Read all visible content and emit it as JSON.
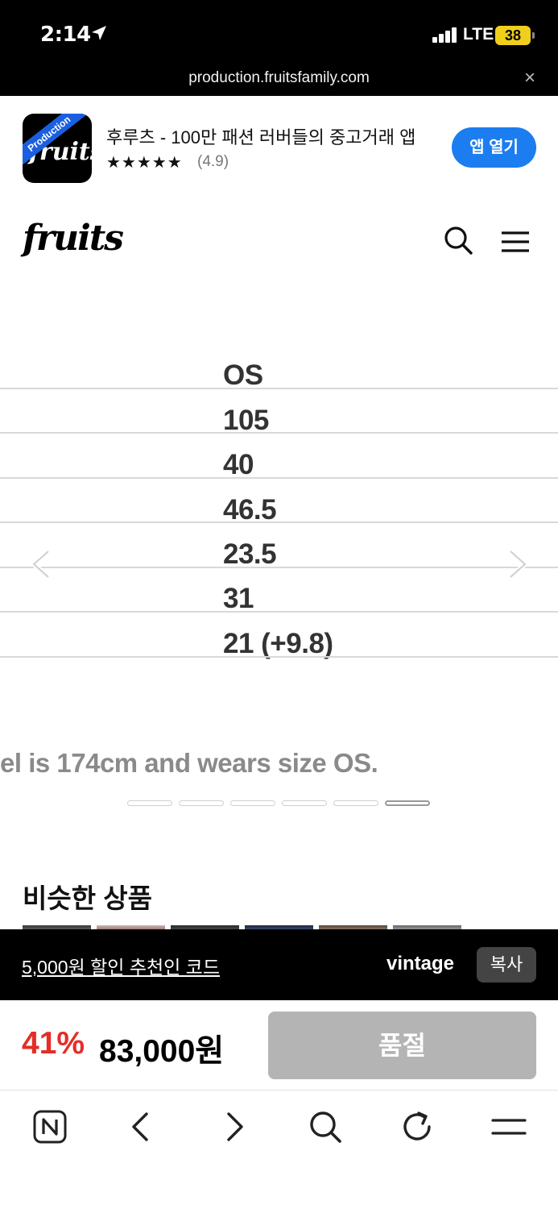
{
  "status_bar": {
    "time": "2:14",
    "network": "LTE",
    "battery": "38"
  },
  "url_bar": {
    "url": "production.fruitsfamily.com",
    "close": "×"
  },
  "app_banner": {
    "ribbon": "Production",
    "icon_logo": "fruits",
    "title": "후루츠 - 100만 패션 러버들의 중고거래 앱",
    "stars": "★★★★★",
    "rating": "(4.9)",
    "open_label": "앱 열기"
  },
  "site_header": {
    "logo": "fruits"
  },
  "size_table": {
    "rows": [
      "OS",
      "105",
      "40",
      "46.5",
      "23.5",
      "31",
      "21 (+9.8)"
    ]
  },
  "caption": "el is 174cm and wears size OS.",
  "pagination": {
    "total": 6,
    "active": 6
  },
  "similar": {
    "title": "비슷한 상품"
  },
  "referral": {
    "text": "5,000원 할인 추천인 코드",
    "code": "vintage",
    "copy_label": "복사"
  },
  "price_bar": {
    "discount": "41%",
    "price": "83,000원",
    "soldout_label": "품절"
  },
  "colors": {
    "accent": "#1c7df0",
    "discount": "#e52d27",
    "ribbon": "#1a5fe0",
    "battery": "#f0cf1c"
  }
}
